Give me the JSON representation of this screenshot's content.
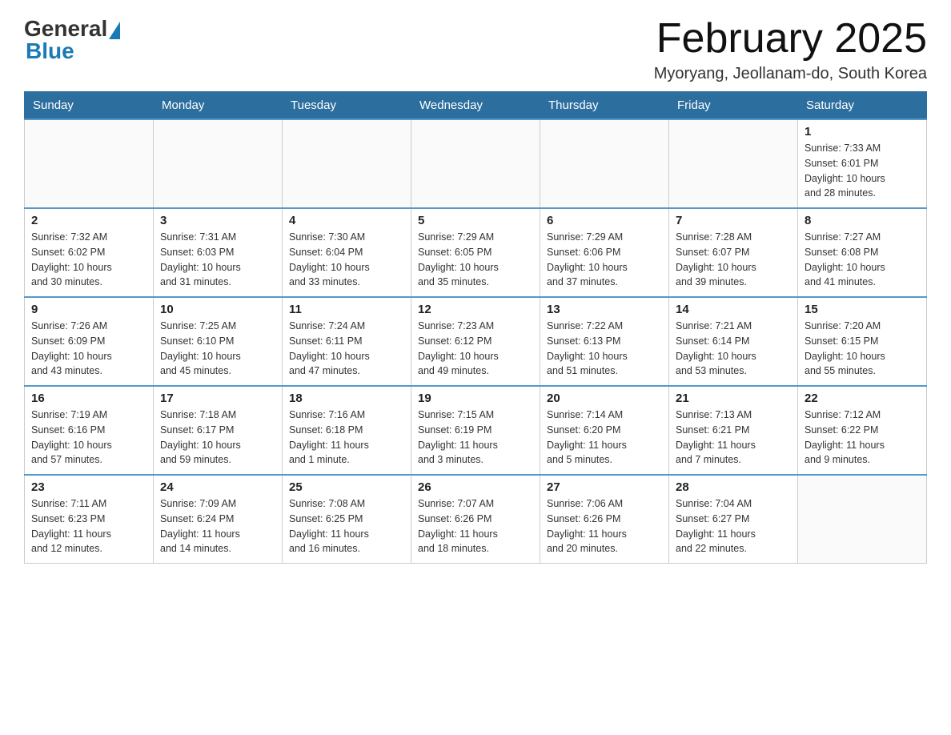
{
  "header": {
    "logo": {
      "general": "General",
      "blue": "Blue"
    },
    "title": "February 2025",
    "location": "Myoryang, Jeollanam-do, South Korea"
  },
  "weekdays": [
    "Sunday",
    "Monday",
    "Tuesday",
    "Wednesday",
    "Thursday",
    "Friday",
    "Saturday"
  ],
  "weeks": [
    [
      {
        "day": "",
        "info": ""
      },
      {
        "day": "",
        "info": ""
      },
      {
        "day": "",
        "info": ""
      },
      {
        "day": "",
        "info": ""
      },
      {
        "day": "",
        "info": ""
      },
      {
        "day": "",
        "info": ""
      },
      {
        "day": "1",
        "info": "Sunrise: 7:33 AM\nSunset: 6:01 PM\nDaylight: 10 hours\nand 28 minutes."
      }
    ],
    [
      {
        "day": "2",
        "info": "Sunrise: 7:32 AM\nSunset: 6:02 PM\nDaylight: 10 hours\nand 30 minutes."
      },
      {
        "day": "3",
        "info": "Sunrise: 7:31 AM\nSunset: 6:03 PM\nDaylight: 10 hours\nand 31 minutes."
      },
      {
        "day": "4",
        "info": "Sunrise: 7:30 AM\nSunset: 6:04 PM\nDaylight: 10 hours\nand 33 minutes."
      },
      {
        "day": "5",
        "info": "Sunrise: 7:29 AM\nSunset: 6:05 PM\nDaylight: 10 hours\nand 35 minutes."
      },
      {
        "day": "6",
        "info": "Sunrise: 7:29 AM\nSunset: 6:06 PM\nDaylight: 10 hours\nand 37 minutes."
      },
      {
        "day": "7",
        "info": "Sunrise: 7:28 AM\nSunset: 6:07 PM\nDaylight: 10 hours\nand 39 minutes."
      },
      {
        "day": "8",
        "info": "Sunrise: 7:27 AM\nSunset: 6:08 PM\nDaylight: 10 hours\nand 41 minutes."
      }
    ],
    [
      {
        "day": "9",
        "info": "Sunrise: 7:26 AM\nSunset: 6:09 PM\nDaylight: 10 hours\nand 43 minutes."
      },
      {
        "day": "10",
        "info": "Sunrise: 7:25 AM\nSunset: 6:10 PM\nDaylight: 10 hours\nand 45 minutes."
      },
      {
        "day": "11",
        "info": "Sunrise: 7:24 AM\nSunset: 6:11 PM\nDaylight: 10 hours\nand 47 minutes."
      },
      {
        "day": "12",
        "info": "Sunrise: 7:23 AM\nSunset: 6:12 PM\nDaylight: 10 hours\nand 49 minutes."
      },
      {
        "day": "13",
        "info": "Sunrise: 7:22 AM\nSunset: 6:13 PM\nDaylight: 10 hours\nand 51 minutes."
      },
      {
        "day": "14",
        "info": "Sunrise: 7:21 AM\nSunset: 6:14 PM\nDaylight: 10 hours\nand 53 minutes."
      },
      {
        "day": "15",
        "info": "Sunrise: 7:20 AM\nSunset: 6:15 PM\nDaylight: 10 hours\nand 55 minutes."
      }
    ],
    [
      {
        "day": "16",
        "info": "Sunrise: 7:19 AM\nSunset: 6:16 PM\nDaylight: 10 hours\nand 57 minutes."
      },
      {
        "day": "17",
        "info": "Sunrise: 7:18 AM\nSunset: 6:17 PM\nDaylight: 10 hours\nand 59 minutes."
      },
      {
        "day": "18",
        "info": "Sunrise: 7:16 AM\nSunset: 6:18 PM\nDaylight: 11 hours\nand 1 minute."
      },
      {
        "day": "19",
        "info": "Sunrise: 7:15 AM\nSunset: 6:19 PM\nDaylight: 11 hours\nand 3 minutes."
      },
      {
        "day": "20",
        "info": "Sunrise: 7:14 AM\nSunset: 6:20 PM\nDaylight: 11 hours\nand 5 minutes."
      },
      {
        "day": "21",
        "info": "Sunrise: 7:13 AM\nSunset: 6:21 PM\nDaylight: 11 hours\nand 7 minutes."
      },
      {
        "day": "22",
        "info": "Sunrise: 7:12 AM\nSunset: 6:22 PM\nDaylight: 11 hours\nand 9 minutes."
      }
    ],
    [
      {
        "day": "23",
        "info": "Sunrise: 7:11 AM\nSunset: 6:23 PM\nDaylight: 11 hours\nand 12 minutes."
      },
      {
        "day": "24",
        "info": "Sunrise: 7:09 AM\nSunset: 6:24 PM\nDaylight: 11 hours\nand 14 minutes."
      },
      {
        "day": "25",
        "info": "Sunrise: 7:08 AM\nSunset: 6:25 PM\nDaylight: 11 hours\nand 16 minutes."
      },
      {
        "day": "26",
        "info": "Sunrise: 7:07 AM\nSunset: 6:26 PM\nDaylight: 11 hours\nand 18 minutes."
      },
      {
        "day": "27",
        "info": "Sunrise: 7:06 AM\nSunset: 6:26 PM\nDaylight: 11 hours\nand 20 minutes."
      },
      {
        "day": "28",
        "info": "Sunrise: 7:04 AM\nSunset: 6:27 PM\nDaylight: 11 hours\nand 22 minutes."
      },
      {
        "day": "",
        "info": ""
      }
    ]
  ]
}
